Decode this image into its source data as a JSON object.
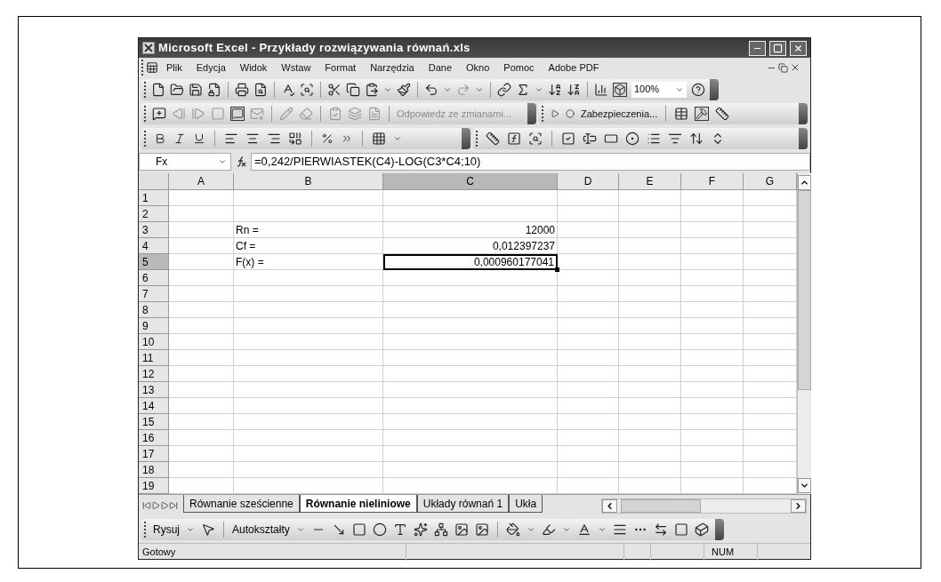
{
  "window": {
    "title": "Microsoft Excel - Przykłady rozwiązywania równań.xls"
  },
  "menu": [
    "Plik",
    "Edycja",
    "Widok",
    "Wstaw",
    "Format",
    "Narzędzia",
    "Dane",
    "Okno",
    "Pomoc",
    "Adobe PDF"
  ],
  "toolbars": {
    "zoom": "100%",
    "reviewing": {
      "text": "Odpowiedz ze zmianami...",
      "disabled": true
    },
    "security": "Zabezpieczenia..."
  },
  "formula_bar": {
    "name_box": "Fx",
    "formula": "=0,242/PIERWIASTEK(C4)-LOG(C3*C4;10)"
  },
  "columns": [
    {
      "label": "A",
      "selected": false
    },
    {
      "label": "B",
      "selected": false
    },
    {
      "label": "C",
      "selected": true
    },
    {
      "label": "D",
      "selected": false
    },
    {
      "label": "E",
      "selected": false
    },
    {
      "label": "F",
      "selected": false
    },
    {
      "label": "G",
      "selected": false
    }
  ],
  "rows": [
    {
      "label": "1",
      "selected": false,
      "cells": [
        null,
        null,
        null,
        null,
        null,
        null,
        null
      ]
    },
    {
      "label": "2",
      "selected": false,
      "cells": [
        null,
        null,
        null,
        null,
        null,
        null,
        null
      ]
    },
    {
      "label": "3",
      "selected": false,
      "cells": [
        null,
        {
          "text": "Rn =",
          "selected": false
        },
        {
          "text": "12000",
          "selected": false
        },
        null,
        null,
        null,
        null
      ]
    },
    {
      "label": "4",
      "selected": false,
      "cells": [
        null,
        {
          "text": "Cf =",
          "selected": false
        },
        {
          "text": "0,012397237",
          "selected": false
        },
        null,
        null,
        null,
        null
      ]
    },
    {
      "label": "5",
      "selected": true,
      "cells": [
        null,
        {
          "text": "F(x) =",
          "selected": false
        },
        {
          "text": "0,000960177041",
          "selected": true
        },
        null,
        null,
        null,
        null
      ]
    },
    {
      "label": "6",
      "selected": false,
      "cells": [
        null,
        null,
        null,
        null,
        null,
        null,
        null
      ]
    },
    {
      "label": "7",
      "selected": false,
      "cells": [
        null,
        null,
        null,
        null,
        null,
        null,
        null
      ]
    },
    {
      "label": "8",
      "selected": false,
      "cells": [
        null,
        null,
        null,
        null,
        null,
        null,
        null
      ]
    },
    {
      "label": "9",
      "selected": false,
      "cells": [
        null,
        null,
        null,
        null,
        null,
        null,
        null
      ]
    },
    {
      "label": "10",
      "selected": false,
      "cells": [
        null,
        null,
        null,
        null,
        null,
        null,
        null
      ]
    },
    {
      "label": "11",
      "selected": false,
      "cells": [
        null,
        null,
        null,
        null,
        null,
        null,
        null
      ]
    },
    {
      "label": "12",
      "selected": false,
      "cells": [
        null,
        null,
        null,
        null,
        null,
        null,
        null
      ]
    },
    {
      "label": "13",
      "selected": false,
      "cells": [
        null,
        null,
        null,
        null,
        null,
        null,
        null
      ]
    },
    {
      "label": "14",
      "selected": false,
      "cells": [
        null,
        null,
        null,
        null,
        null,
        null,
        null
      ]
    },
    {
      "label": "15",
      "selected": false,
      "cells": [
        null,
        null,
        null,
        null,
        null,
        null,
        null
      ]
    },
    {
      "label": "16",
      "selected": false,
      "cells": [
        null,
        null,
        null,
        null,
        null,
        null,
        null
      ]
    },
    {
      "label": "17",
      "selected": false,
      "cells": [
        null,
        null,
        null,
        null,
        null,
        null,
        null
      ]
    },
    {
      "label": "18",
      "selected": false,
      "cells": [
        null,
        null,
        null,
        null,
        null,
        null,
        null
      ]
    },
    {
      "label": "19",
      "selected": false,
      "cells": [
        null,
        null,
        null,
        null,
        null,
        null,
        null
      ]
    }
  ],
  "sheet_tabs": [
    {
      "label": "Równanie sześcienne",
      "selected": false
    },
    {
      "label": "Równanie nieliniowe",
      "selected": true
    },
    {
      "label": "Układy równań 1",
      "selected": false
    },
    {
      "label": "Ukła",
      "selected": false
    }
  ],
  "drawing_toolbar": {
    "draw": "Rysuj",
    "autoshapes": "Autokształty"
  },
  "status_bar": {
    "text": "Gotowy",
    "num": "NUM"
  }
}
